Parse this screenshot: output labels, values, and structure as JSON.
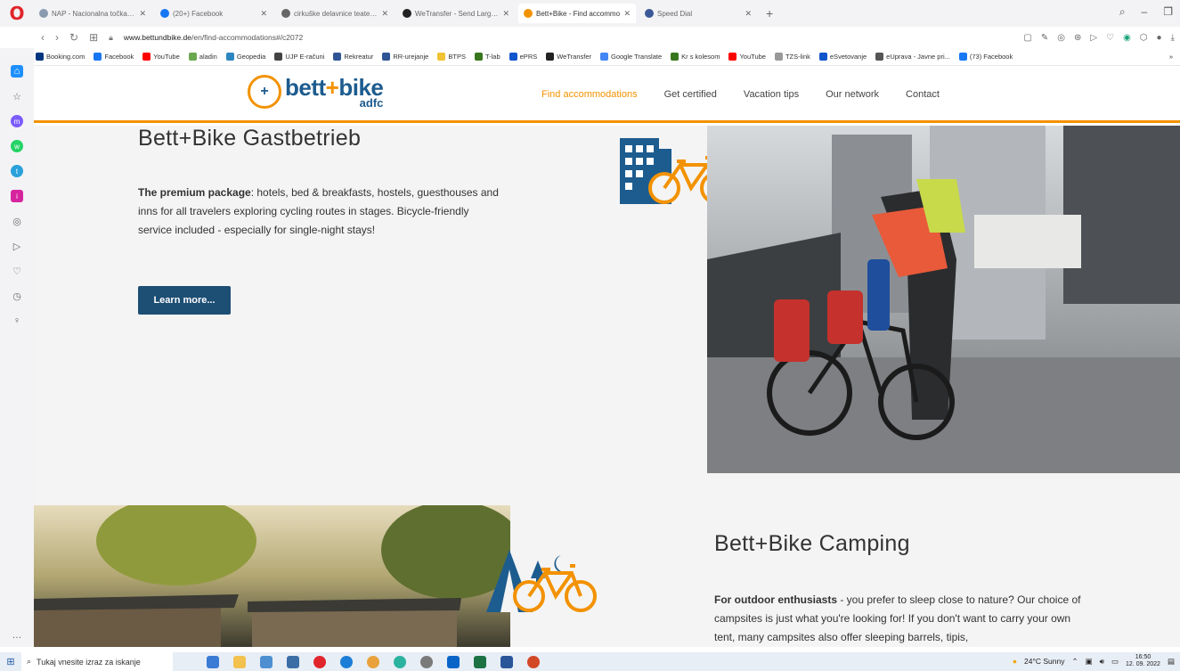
{
  "browser": {
    "tabs": [
      {
        "label": "NAP - Nacionalna točka do",
        "color": "#8a9bb0"
      },
      {
        "label": "(20+) Facebook",
        "color": "#1877f2"
      },
      {
        "label": "cirkuške delavnice teate cir",
        "color": "#666666"
      },
      {
        "label": "WeTransfer - Send Large Fil",
        "color": "#222222"
      },
      {
        "label": "Bett+Bike - Find accommo",
        "color": "#f39200",
        "active": true
      },
      {
        "label": "Speed Dial",
        "color": "#3b5998"
      }
    ],
    "new_tab": "+",
    "address": {
      "domain": "www.bettundbike.de",
      "path": "/en/find-accommodations#/c2072"
    },
    "bookmarks": [
      {
        "label": "Booking.com",
        "color": "#003580"
      },
      {
        "label": "Facebook",
        "color": "#1877f2"
      },
      {
        "label": "YouTube",
        "color": "#ff0000"
      },
      {
        "label": "aladin",
        "color": "#6aa84f"
      },
      {
        "label": "Geopedia",
        "color": "#2e86c1"
      },
      {
        "label": "UJP E-računi",
        "color": "#444444"
      },
      {
        "label": "Rekreatur",
        "color": "#2f5597"
      },
      {
        "label": "RR-urejanje",
        "color": "#2f5597"
      },
      {
        "label": "BTPS",
        "color": "#f1c232"
      },
      {
        "label": "T-lab",
        "color": "#38761d"
      },
      {
        "label": "ePRS",
        "color": "#1155cc"
      },
      {
        "label": "WeTransfer",
        "color": "#222222"
      },
      {
        "label": "Google Translate",
        "color": "#4285f4"
      },
      {
        "label": "Kr s kolesom",
        "color": "#38761d"
      },
      {
        "label": "YouTube",
        "color": "#ff0000"
      },
      {
        "label": "TZS-link",
        "color": "#999999"
      },
      {
        "label": "eSvetovanje",
        "color": "#1155cc"
      },
      {
        "label": "eUprava - Javne pri...",
        "color": "#555555"
      },
      {
        "label": "(73) Facebook",
        "color": "#1877f2"
      }
    ],
    "more_bookmarks": "»"
  },
  "site": {
    "logo_text_a": "bett",
    "logo_plus": "+",
    "logo_text_b": "bike",
    "logo_sub": "adfc",
    "nav": [
      {
        "label": "Find accommodations",
        "active": true
      },
      {
        "label": "Get certified"
      },
      {
        "label": "Vacation tips"
      },
      {
        "label": "Our network"
      },
      {
        "label": "Contact"
      }
    ],
    "accent_color": "#f39200",
    "brand_color": "#1d5c8f"
  },
  "section1": {
    "title": "Bett+Bike Gastbetrieb",
    "lead_bold": "The premium package",
    "text": ": hotels, bed & breakfasts, hostels, guesthouses and inns for all travelers exploring cycling routes in stages. Bicycle-friendly service included - especially for single-night stays!",
    "button": "Learn more..."
  },
  "section2": {
    "title": "Bett+Bike Camping",
    "lead_bold": "For outdoor enthusiasts",
    "text": " - you prefer to sleep close to nature? Our choice of campsites is just what you're looking for! If you don't want to carry your own tent, many campsites also offer sleeping barrels, tipis,"
  },
  "taskbar": {
    "search_placeholder": "Tukaj vnesite izraz za iskanje",
    "weather": "24°C  Sunny",
    "time": "16:50",
    "date": "12. 09. 2022"
  }
}
